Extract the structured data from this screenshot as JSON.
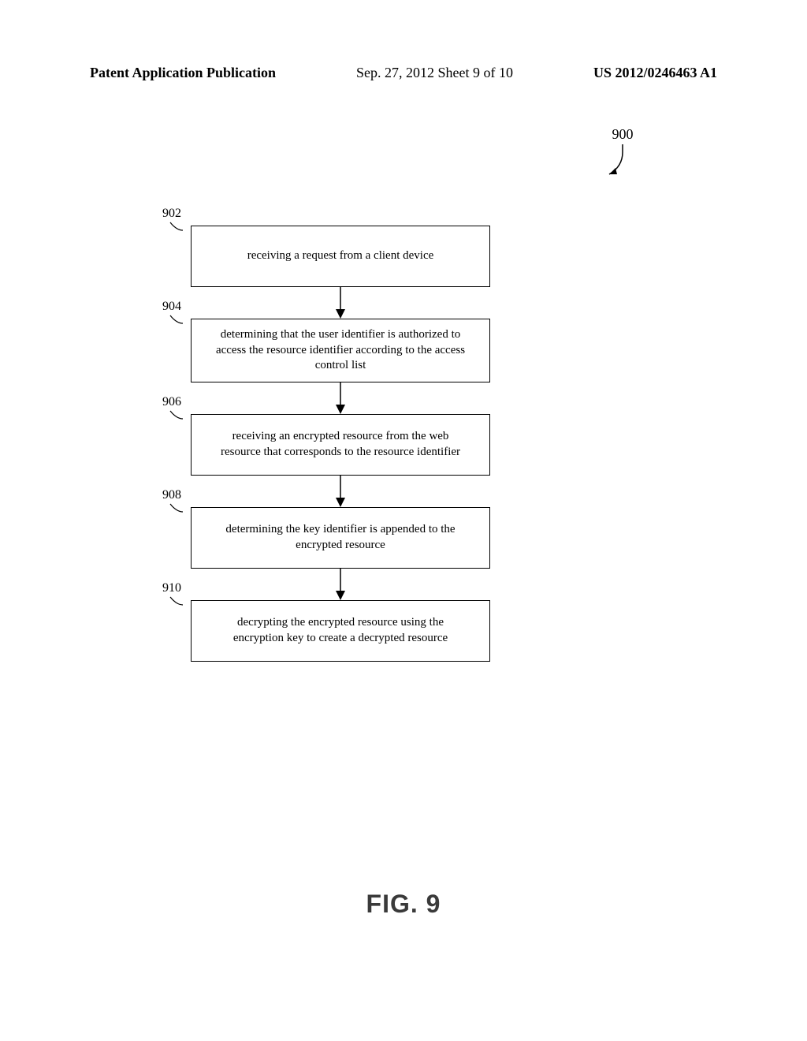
{
  "header": {
    "left": "Patent Application Publication",
    "middle": "Sep. 27, 2012  Sheet 9 of 10",
    "right": "US 2012/0246463 A1"
  },
  "figure_ref": "900",
  "steps": [
    {
      "ref": "902",
      "text": "receiving a request from a client device"
    },
    {
      "ref": "904",
      "text": "determining that the user identifier is authorized to access the resource identifier according to the access control list"
    },
    {
      "ref": "906",
      "text": "receiving an encrypted resource from the web resource that corresponds to the resource identifier"
    },
    {
      "ref": "908",
      "text": "determining the key identifier is appended to the encrypted resource"
    },
    {
      "ref": "910",
      "text": "decrypting the encrypted resource using the encryption key to create a decrypted resource"
    }
  ],
  "figure_title": "FIG. 9"
}
